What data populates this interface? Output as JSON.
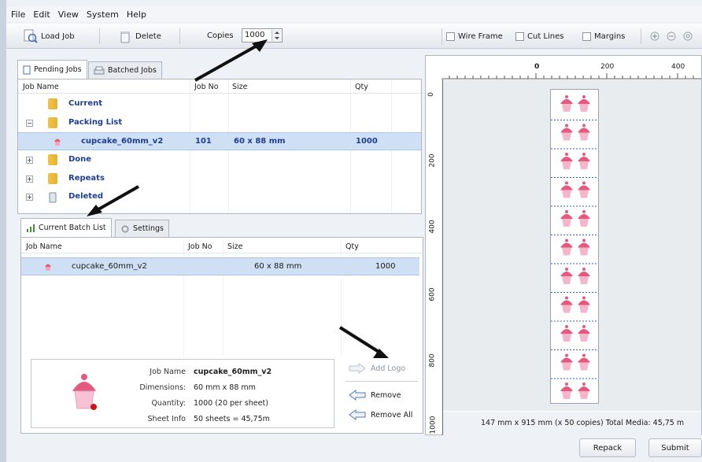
{
  "menu": [
    "File",
    "Edit",
    "View",
    "System",
    "Help"
  ],
  "toolbar": {
    "load_job": "Load Job",
    "delete": "Delete",
    "copies_label": "Copies",
    "copies_value": "1000",
    "wire_frame": "Wire Frame",
    "cut_lines": "Cut Lines",
    "margins": "Margins"
  },
  "top_tabs": {
    "pending": "Pending Jobs",
    "batched": "Batched Jobs"
  },
  "jobs_table": {
    "headers": {
      "name": "Job Name",
      "no": "Job No",
      "size": "Size",
      "qty": "Qty"
    },
    "rows": [
      {
        "name": "Current"
      },
      {
        "name": "Packing List"
      },
      {
        "name": "cupcake_60mm_v2",
        "no": "101",
        "size": "60 x 88  mm",
        "qty": "1000"
      },
      {
        "name": "Done"
      },
      {
        "name": "Repeats"
      },
      {
        "name": "Deleted"
      }
    ]
  },
  "bottom_tabs": {
    "batch": "Current Batch List",
    "settings": "Settings"
  },
  "batch_table": {
    "headers": {
      "name": "Job Name",
      "no": "Job No",
      "size": "Size",
      "qty": "Qty"
    },
    "row": {
      "name": "cupcake_60mm_v2",
      "size": "60 x 88  mm",
      "qty": "1000"
    }
  },
  "details": {
    "job_name_label": "Job Name",
    "job_name": "cupcake_60mm_v2",
    "dimensions_label": "Dimensions:",
    "dimensions": "60 mm x 88 mm",
    "quantity_label": "Quantity:",
    "quantity": "1000 (20 per sheet)",
    "sheet_label": "Sheet Info",
    "sheet": "50 sheets = 45,75m"
  },
  "actions": {
    "add_logo": "Add Logo",
    "remove": "Remove",
    "remove_all": "Remove All"
  },
  "ruler": {
    "h": [
      "0",
      "200",
      "400"
    ],
    "v": [
      "0",
      "200",
      "400",
      "600",
      "800",
      "1000"
    ]
  },
  "preview_status": "147 mm x 915 mm  (x 50 copies)  Total Media: 45,75 m",
  "buttons": {
    "repack": "Repack",
    "submit": "Submit"
  },
  "colors": {
    "selection": "#cfe0f5",
    "link": "#1e3f8f",
    "cut_line": "#2f5fc7",
    "cupcake": "#e35a7e"
  }
}
